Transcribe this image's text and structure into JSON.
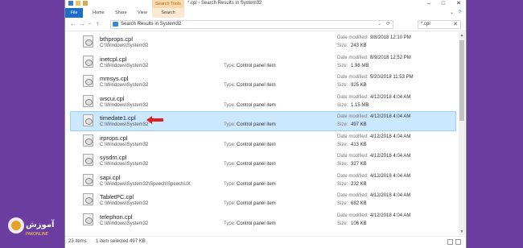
{
  "window": {
    "title": "*.cpl - Search Results in System32",
    "search_tools_tab": "Search Tools",
    "controls": {
      "minimize": "–",
      "maximize": "□",
      "close": "✕"
    }
  },
  "ribbon": {
    "tabs": [
      {
        "label": "File"
      },
      {
        "label": "Home"
      },
      {
        "label": "Share"
      },
      {
        "label": "View"
      },
      {
        "label": "Search"
      }
    ],
    "chevron": "⌄",
    "help": "?"
  },
  "address": {
    "back": "←",
    "forward": "→",
    "recent": "⌄",
    "up": "↑",
    "path": "Search Results in System32",
    "dropdown": "⌄",
    "refresh": "⟳",
    "search_value": "*.cpl",
    "search_clear": "✕"
  },
  "labels": {
    "type": "Type:",
    "date_modified": "Date modified:",
    "size": "Size:"
  },
  "files": [
    {
      "name": "bthprops.cpl",
      "path": "C:\\Windows\\System32",
      "type": "",
      "modified": "9/8/2018 12:10 PM",
      "size": "243 KB"
    },
    {
      "name": "inetcpl.cpl",
      "path": "C:\\Windows\\System32",
      "type": "Control panel item",
      "modified": "8/9/2018 12:52 PM",
      "size": "1.98 MB"
    },
    {
      "name": "mmsys.cpl",
      "path": "C:\\Windows\\System32",
      "type": "Control panel item",
      "modified": "5/20/2018 11:53 PM",
      "size": "925 KB"
    },
    {
      "name": "wscui.cpl",
      "path": "C:\\Windows\\System32",
      "type": "Control panel item",
      "modified": "4/12/2018 4:04 AM",
      "size": "1.15 MB"
    },
    {
      "name": "timedate1.cpl",
      "path": "C:\\Windows\\System32",
      "type": "Control panel item",
      "modified": "4/12/2018 4:04 AM",
      "size": "497 KB"
    },
    {
      "name": "irprops.cpl",
      "path": "C:\\Windows\\System32",
      "type": "Control panel item",
      "modified": "4/12/2018 4:04 AM",
      "size": "413 KB"
    },
    {
      "name": "sysdm.cpl",
      "path": "C:\\Windows\\System32",
      "type": "Control panel item",
      "modified": "4/12/2018 4:04 AM",
      "size": "327 KB"
    },
    {
      "name": "sapi.cpl",
      "path": "C:\\Windows\\System32\\Speech\\SpeechUX",
      "type": "Control panel item",
      "modified": "4/12/2018 4:04 AM",
      "size": "232 KB"
    },
    {
      "name": "TabletPC.cpl",
      "path": "C:\\Windows\\System32",
      "type": "Control panel item",
      "modified": "4/12/2018 4:04 AM",
      "size": "682 KB"
    },
    {
      "name": "telephon.cpl",
      "path": "C:\\Windows\\System32",
      "type": "Control panel item",
      "modified": "4/12/2018 4:04 AM",
      "size": "106 KB"
    }
  ],
  "selected_index": 4,
  "status": {
    "count": "23 items",
    "selection": "1 item selected  497 KB"
  },
  "colors": {
    "background": "#6c3da0",
    "selection": "#cce8ff",
    "accent": "#1e6cc8",
    "arrow": "#e02020"
  },
  "logo": {
    "text": "آموزش",
    "subtext": "PAKONLINE"
  }
}
